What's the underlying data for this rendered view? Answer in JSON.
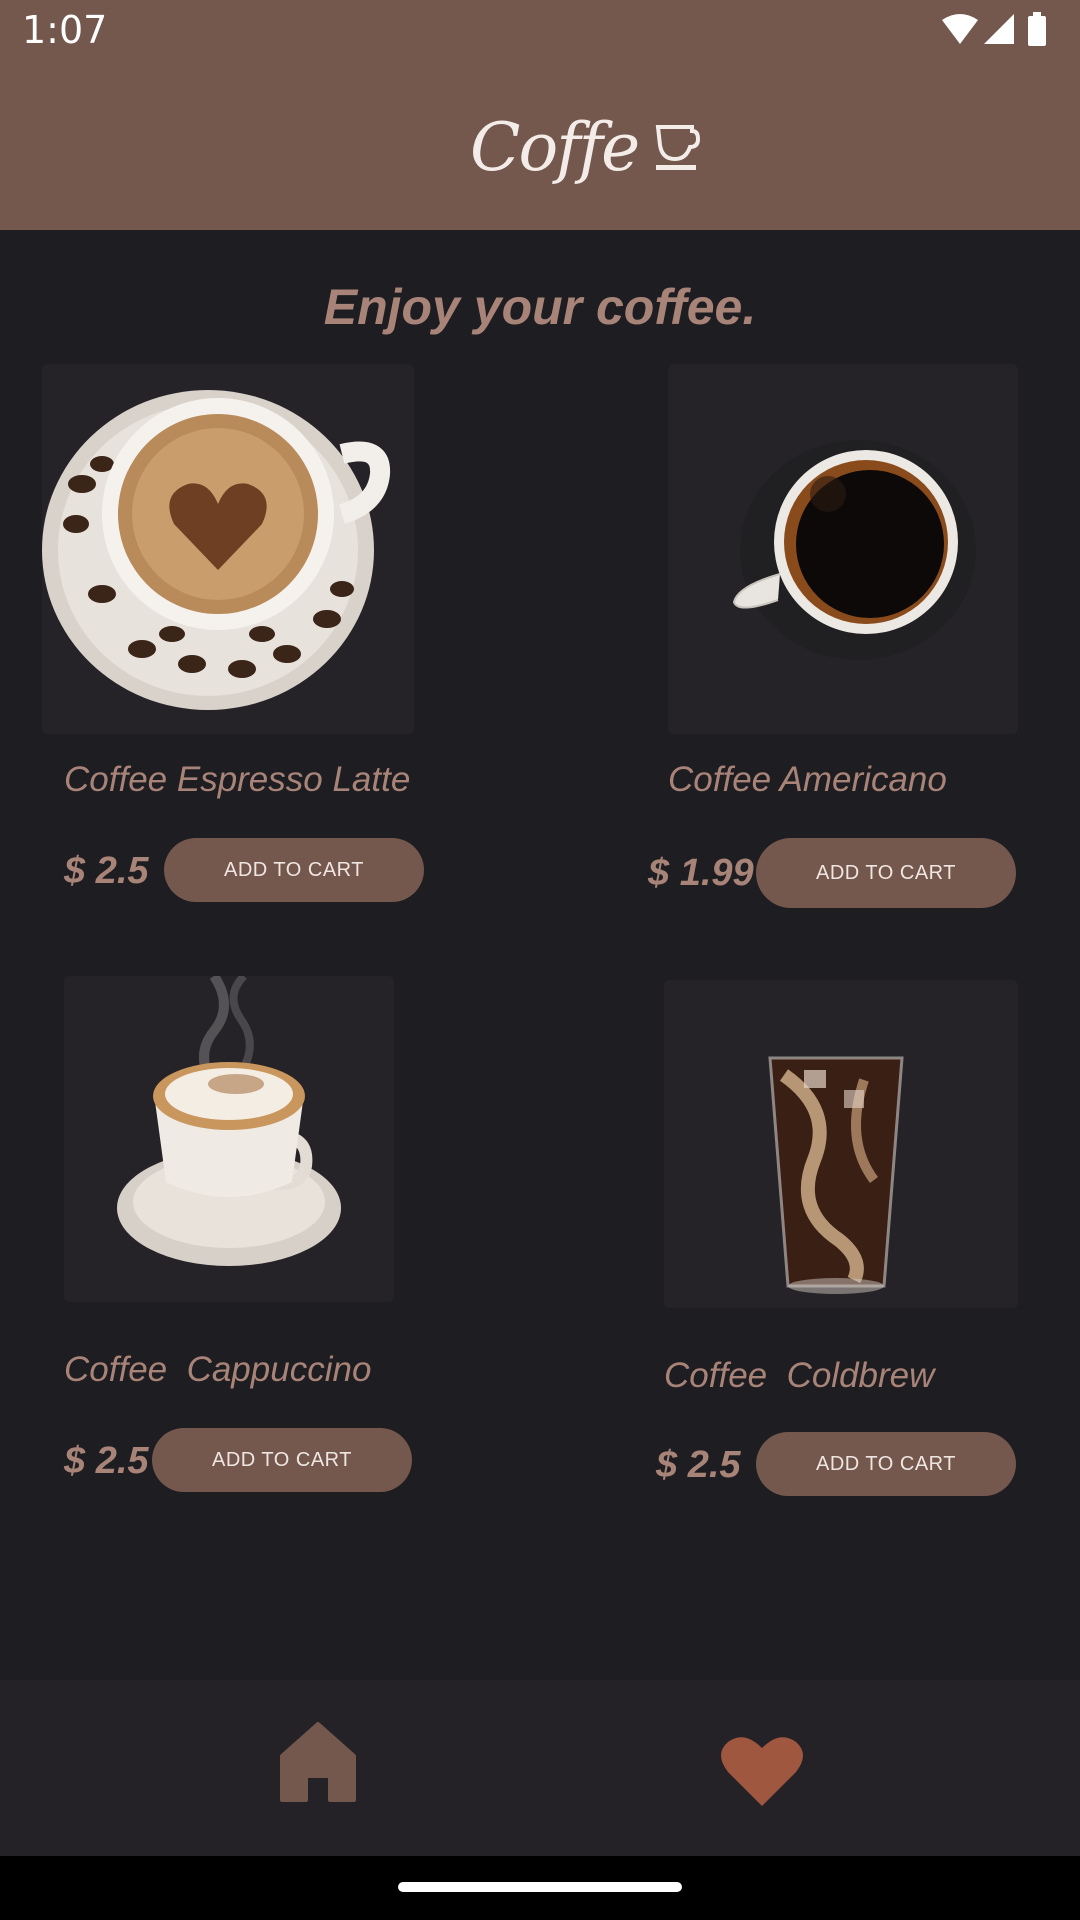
{
  "status_bar": {
    "time": "1:07"
  },
  "app_bar": {
    "logo_text": "Coffe"
  },
  "headline": "Enjoy your coffee.",
  "products": [
    {
      "name": "Coffee Espresso Latte",
      "price": "$ 2.5",
      "button": "ADD TO CART"
    },
    {
      "name": "Coffee Americano",
      "price": "$ 1.99",
      "button": "ADD TO CART"
    },
    {
      "name": "Coffee  Cappuccino",
      "price": "$ 2.5",
      "button": "ADD TO CART"
    },
    {
      "name": "Coffee  Coldbrew",
      "price": "$ 2.5",
      "button": "ADD TO CART"
    }
  ],
  "bottom_nav": {
    "items": [
      "home-icon",
      "heart-icon"
    ],
    "active": "heart-icon"
  },
  "colors": {
    "brand": "#74574d",
    "background": "#1e1d22",
    "text_accent": "#a88478",
    "heart": "#a0573f",
    "home": "#74574d"
  }
}
